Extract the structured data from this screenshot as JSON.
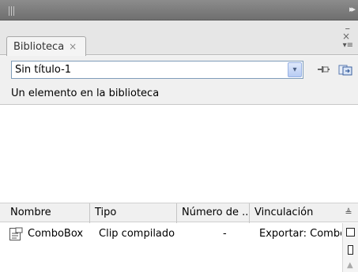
{
  "panel": {
    "tab_label": "Biblioteca",
    "tab_close": "×",
    "win_min": "–",
    "win_close": "×",
    "menu_icon": "▾≡",
    "collapse_icon": "▸▸"
  },
  "document": {
    "selected": "Sin título-1",
    "arrow": "▾"
  },
  "status": {
    "text": "Un elemento en la biblioteca"
  },
  "columns": [
    "Nombre",
    "Tipo",
    "Número de ...",
    "Vinculación"
  ],
  "sort_icon": "≜",
  "rows": [
    {
      "name": "ComboBox",
      "type": "Clip compilado",
      "uses": "-",
      "linkage": "Exportar: Combo"
    }
  ],
  "scroll": {
    "up": "▲"
  }
}
